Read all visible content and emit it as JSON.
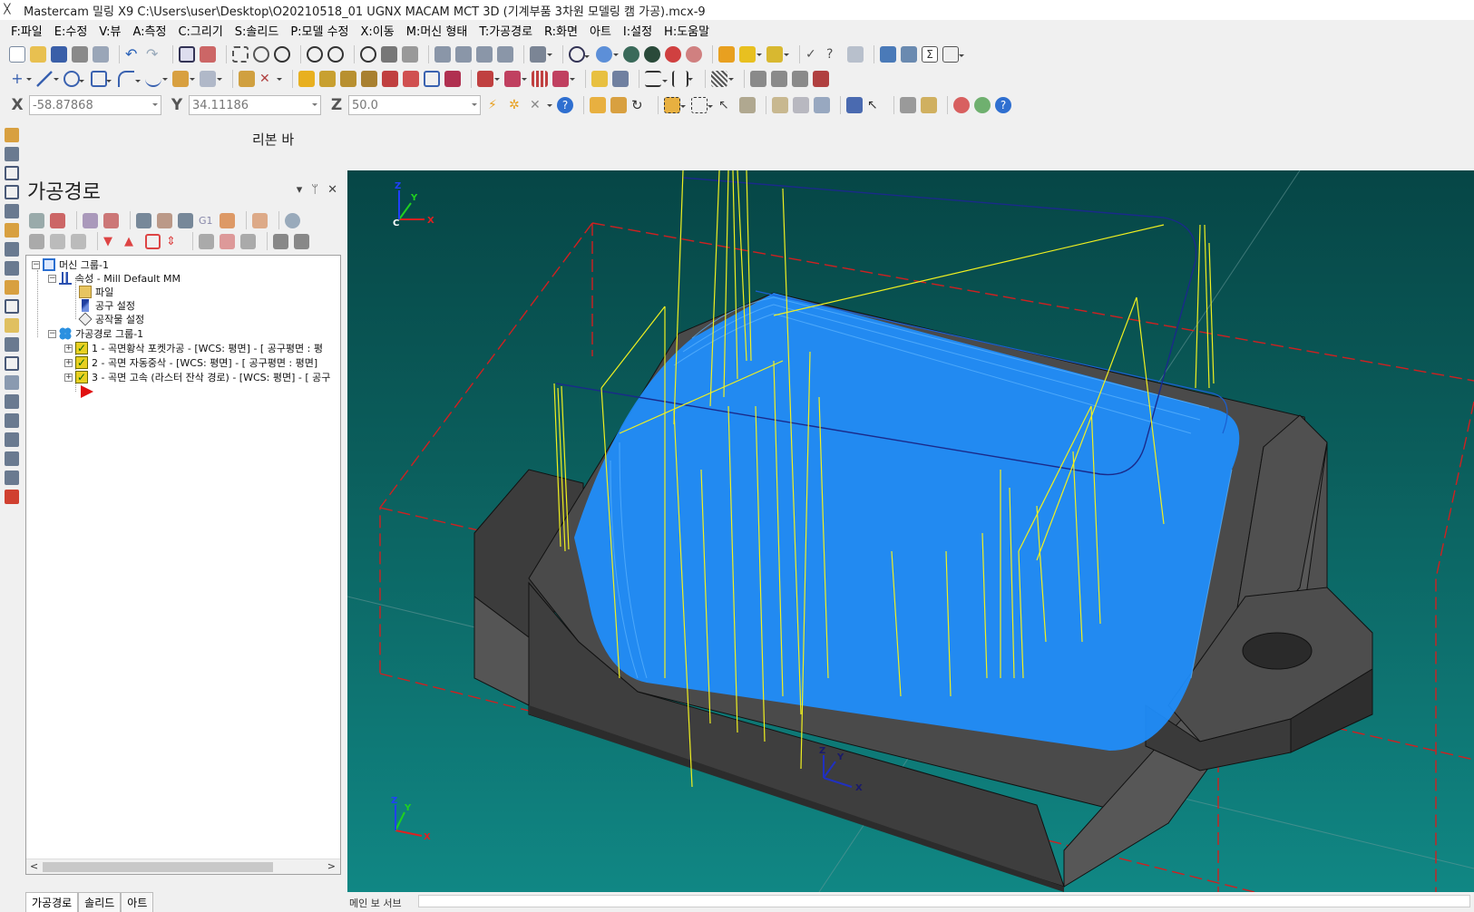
{
  "window": {
    "title": "Mastercam 밀링 X9  C:\\Users\\user\\Desktop\\O20210518_01 UGNX MACAM MCT 3D (기계부품 3차원 모델링 캠 가공).mcx-9"
  },
  "menu": {
    "items": [
      "F:파일",
      "E:수정",
      "V:뷰",
      "A:측정",
      "C:그리기",
      "S:솔리드",
      "P:모델 수정",
      "X:이동",
      "M:머신 형태",
      "T:가공경로",
      "R:화면",
      "아트",
      "I:설정",
      "H:도움말"
    ]
  },
  "coords": {
    "x_label": "X",
    "x_value": "-58.87868",
    "y_label": "Y",
    "y_value": "34.11186",
    "z_label": "Z",
    "z_value": "50.0"
  },
  "ribbon": {
    "label": "리본 바"
  },
  "panel": {
    "title": "가공경로",
    "pin": "ᛘ",
    "close": "✕",
    "tree": {
      "machine_group": "머신 그룹-1",
      "properties": "속성 - Mill Default MM",
      "file": "파일",
      "tool_settings": "공구 설정",
      "stock_setup": "공작물 설정",
      "toolpath_group": "가공경로 그룹-1",
      "op1": "1 - 곡면황삭 포켓가공 - [WCS: 평면] - [  공구평면 : 평",
      "op2": "2 - 곡면 자동중삭 - [WCS: 평면] - [  공구평면 : 평면]",
      "op3": "3 - 곡면 고속 (라스터 잔삭 경로) - [WCS: 평면] - [  공구"
    },
    "tabs": [
      "가공경로",
      "솔리드",
      "아트"
    ]
  },
  "viewport": {
    "gnomon_top": {
      "x": "X",
      "y": "Y",
      "z": "Z",
      "c": "C"
    },
    "gnomon_bottom": {
      "x": "X",
      "y": "Y",
      "z": "Z"
    },
    "gnomon_center": {
      "x": "X",
      "y": "Y",
      "z": "Z"
    }
  },
  "status": {
    "field": "메인 보 서브"
  },
  "colors": {
    "viewport_top": "#064646",
    "viewport_bottom": "#108784",
    "toolpath_blue": "#1e8fff",
    "toolpath_yellow": "#f0f020",
    "stock_boundary": "#d02020",
    "part_gray": "#4a4a4a"
  }
}
